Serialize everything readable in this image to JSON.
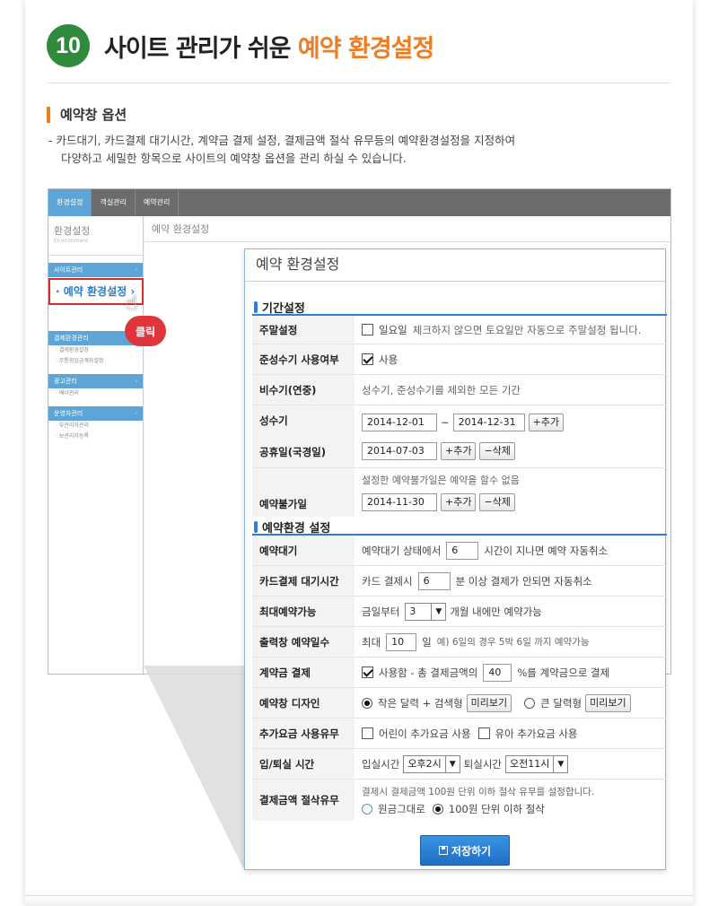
{
  "header": {
    "number": "10",
    "title_main": "사이트 관리가 쉬운 ",
    "title_accent": "예약 환경설정"
  },
  "section": {
    "title": "예약창 옵션",
    "desc_line1": "-  카드대기, 카드결제 대기시간, 계약금 결제 설정, 결제금액 절삭 유무등의 예약환경설정을 지정하여",
    "desc_line2": "다양하고 세밀한 항목으로 사이트의 예약창 옵션을 관리 하실 수 있습니다."
  },
  "admin": {
    "tabs": [
      "환경설정",
      "객실관리",
      "예약관리"
    ],
    "brand": "환경설정",
    "brand_sub": "Environment",
    "main_title": "예약 환경설정",
    "side_cats": [
      "사이트관리",
      "결제환경관리",
      "광고관리",
      "운영자관리"
    ],
    "side_subs": [
      "· 결제환경설정",
      "· 무통장입금계좌설정",
      "· 배너관리",
      "· 부관리자관리",
      "· 보관리자등록"
    ],
    "highlight": "· 예약 환경설정 ›",
    "click_label": "클릭"
  },
  "popup": {
    "title": "예약 환경설정",
    "group1": "기간설정",
    "group2": "예약환경 설정",
    "weekend": {
      "label": "주말설정",
      "option": "일요일",
      "note": "체크하지 않으면 토요일만 자동으로 주말설정 됩니다."
    },
    "semi_peak": {
      "label": "준성수기 사용여부",
      "option": "사용"
    },
    "off_peak": {
      "label": "비수기(연중)",
      "note": "성수기, 준성수기를 제외한 모든 기간"
    },
    "peak": {
      "label": "성수기",
      "start": "2014-12-01",
      "sep": "~",
      "end": "2014-12-31",
      "add": "+추가"
    },
    "holiday": {
      "label": "공휴일(국경일)",
      "date": "2014-07-03",
      "add": "+추가",
      "del": "−삭제"
    },
    "unavailable": {
      "label": "예약불가일",
      "note": "설정한 예약불가일은 예약을 할수 없음",
      "date": "2014-11-30",
      "add": "+추가",
      "del": "−삭제"
    },
    "wait": {
      "label": "예약대기",
      "pre": "예약대기 상태에서",
      "value": "6",
      "post": "시간이 지나면 예약 자동취소"
    },
    "card_wait": {
      "label": "카드결제 대기시간",
      "pre": "카드 결제시",
      "value": "6",
      "post": "분 이상 결제가 안되면 자동취소"
    },
    "max": {
      "label": "최대예약가능",
      "pre": "금일부터",
      "value": "3",
      "post": "개월 내에만 예약가능"
    },
    "days": {
      "label": "출력창 예약일수",
      "pre": "최대",
      "value": "10",
      "unit": "일",
      "note": "예) 6일의 경우 5박 6일 까지 예약가능"
    },
    "deposit": {
      "label": "계약금 결제",
      "pre": "사용함 - 총 결제금액의",
      "value": "40",
      "post": "%를 계약금으로 결제"
    },
    "design": {
      "label": "예약창 디자인",
      "opt1": "작은 달력 + 검색형",
      "preview1": "미리보기",
      "opt2": "큰 달력형",
      "preview2": "미리보기"
    },
    "extra": {
      "label": "추가요금 사용유무",
      "opt1": "어린이 추가요금 사용",
      "opt2": "유아 추가요금 사용"
    },
    "checkinout": {
      "label": "입/퇴실 시간",
      "in_label": "입실시간",
      "in_value": "오후2시",
      "out_label": "퇴실시간",
      "out_value": "오전11시"
    },
    "rounding": {
      "label": "결제금액 절삭유무",
      "note": "결제시 결제금액 100원 단위 이하 절삭 유무를 설정합니다.",
      "opt1": "원금그대로",
      "opt2": "100원 단위 이하 절삭"
    },
    "save": "저장하기"
  }
}
